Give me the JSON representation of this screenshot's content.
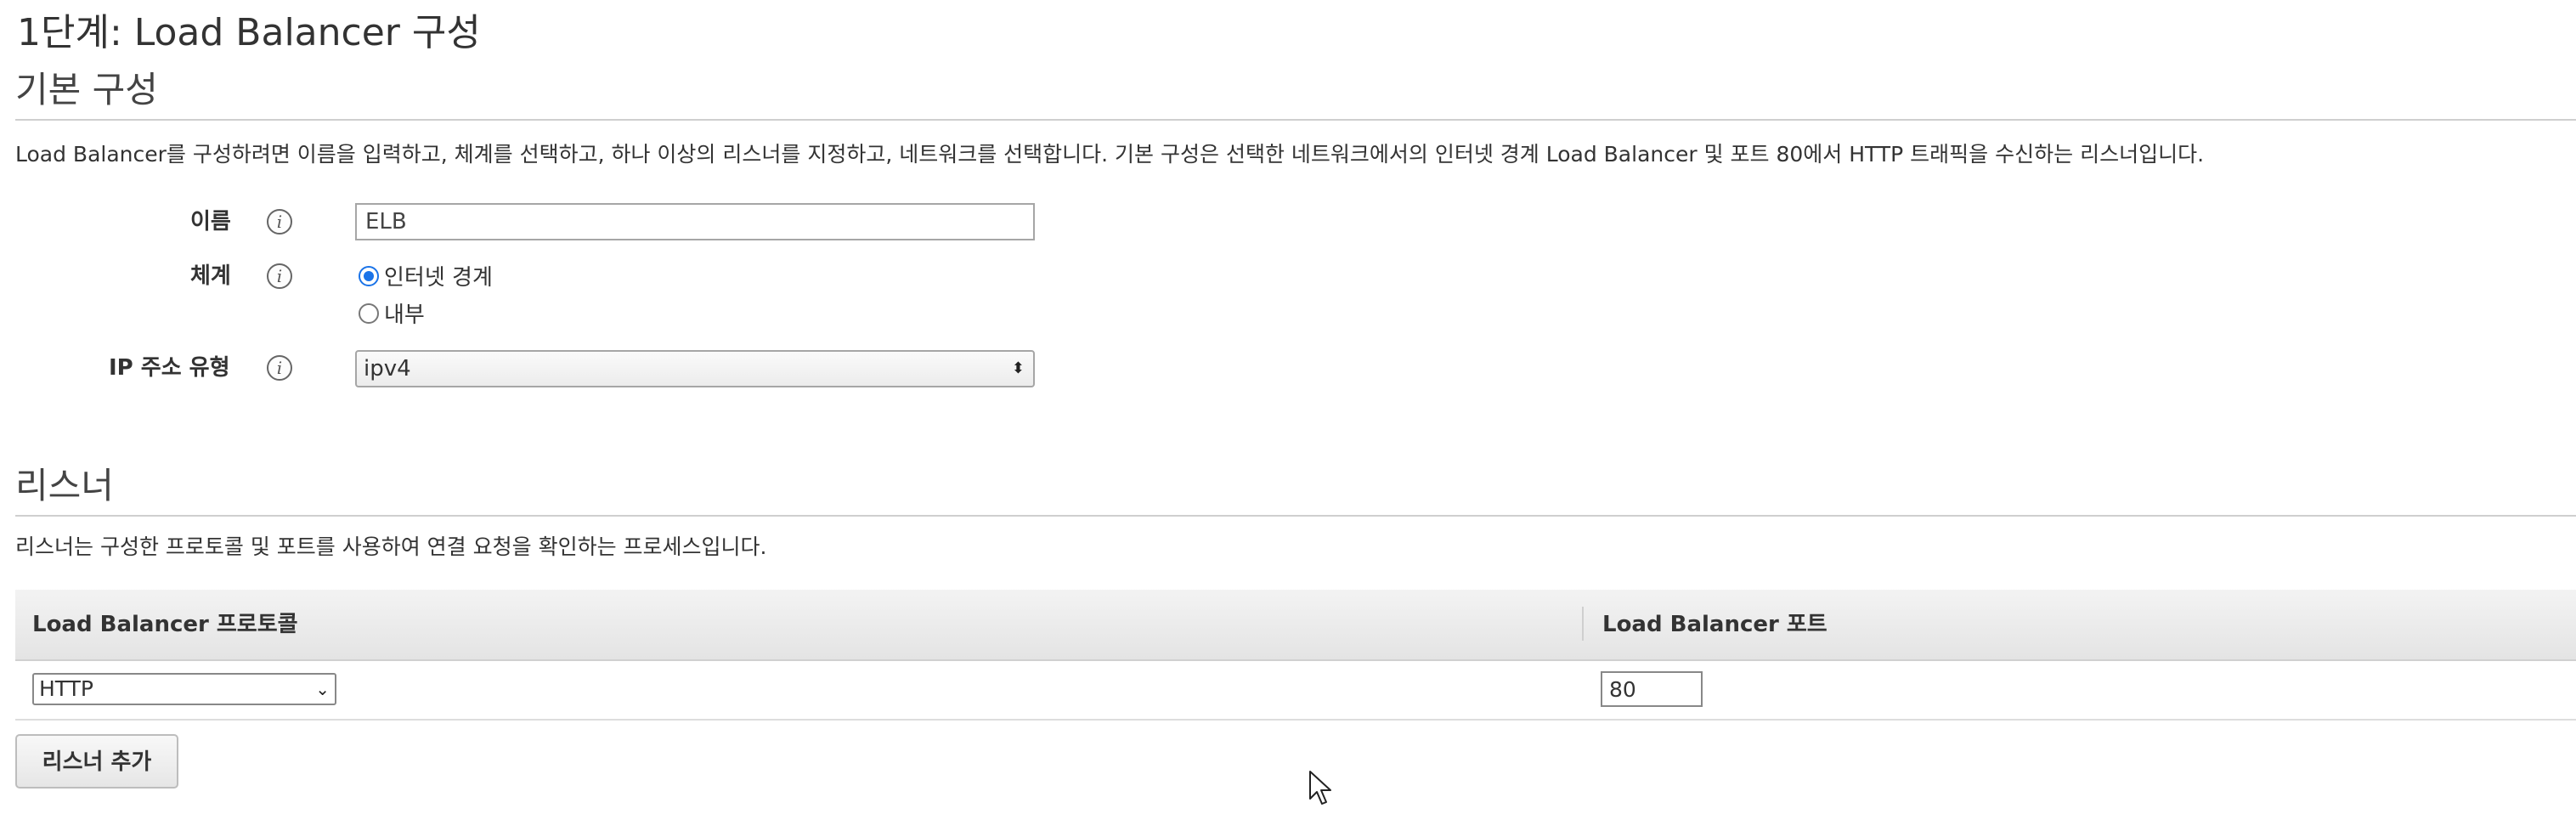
{
  "header": {
    "step_title": "1단계: Load Balancer 구성"
  },
  "basic_config": {
    "title": "기본 구성",
    "description": "Load Balancer를 구성하려면 이름을 입력하고, 체계를 선택하고, 하나 이상의 리스너를 지정하고, 네트워크를 선택합니다. 기본 구성은 선택한 네트워크에서의 인터넷 경계 Load Balancer 및 포트 80에서 HTTP 트래픽을 수신하는 리스너입니다.",
    "name_label": "이름",
    "name_value": "ELB",
    "scheme_label": "체계",
    "scheme_options": [
      {
        "label": "인터넷 경계",
        "checked": true
      },
      {
        "label": "내부",
        "checked": false
      }
    ],
    "ip_type_label": "IP 주소 유형",
    "ip_type_value": "ipv4"
  },
  "listeners": {
    "title": "리스너",
    "description": "리스너는 구성한 프로토콜 및 포트를 사용하여 연결 요청을 확인하는 프로세스입니다.",
    "columns": [
      "Load Balancer 프로토콜",
      "Load Balancer 포트"
    ],
    "rows": [
      {
        "protocol": "HTTP",
        "port": "80"
      }
    ],
    "add_button_label": "리스너 추가"
  },
  "icons": {
    "info": "info-icon",
    "select_arrows": "updown-arrows-icon",
    "chevron": "chevron-down-icon",
    "cursor": "mouse-pointer-icon"
  },
  "colors": {
    "radio_accent": "#1a73e8",
    "header_bg": "#e9e9e9",
    "text": "#333333"
  }
}
